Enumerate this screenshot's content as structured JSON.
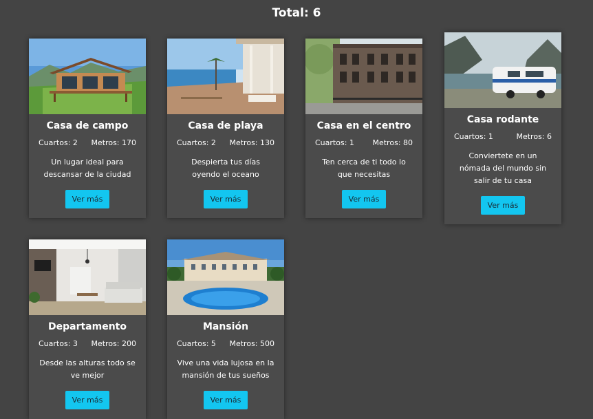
{
  "header": {
    "total_label": "Total: 6"
  },
  "stats_labels": {
    "rooms": "Cuartos:",
    "meters": "Metros:"
  },
  "cards": [
    {
      "title": "Casa de campo",
      "rooms": "Cuartos: 2",
      "meters": "Metros: 170",
      "description": "Un lugar ideal para descansar de la ciudad",
      "button": "Ver más"
    },
    {
      "title": "Casa de playa",
      "rooms": "Cuartos: 2",
      "meters": "Metros: 130",
      "description": "Despierta tus días oyendo el oceano",
      "button": "Ver más"
    },
    {
      "title": "Casa en el centro",
      "rooms": "Cuartos: 1",
      "meters": "Metros: 80",
      "description": "Ten cerca de ti todo lo que necesitas",
      "button": "Ver más"
    },
    {
      "title": "Casa rodante",
      "rooms": "Cuartos: 1",
      "meters": "Metros: 6",
      "description": "Conviertete en un nómada del mundo sin salir de tu casa",
      "button": "Ver más"
    },
    {
      "title": "Departamento",
      "rooms": "Cuartos: 3",
      "meters": "Metros: 200",
      "description": "Desde las alturas todo se ve mejor",
      "button": "Ver más"
    },
    {
      "title": "Mansión",
      "rooms": "Cuartos: 5",
      "meters": "Metros: 500",
      "description": "Vive una vida lujosa en la mansión de tus sueños",
      "button": "Ver más"
    }
  ],
  "colors": {
    "background": "#444444",
    "card": "#4b4b4b",
    "button": "#13c6f0"
  }
}
